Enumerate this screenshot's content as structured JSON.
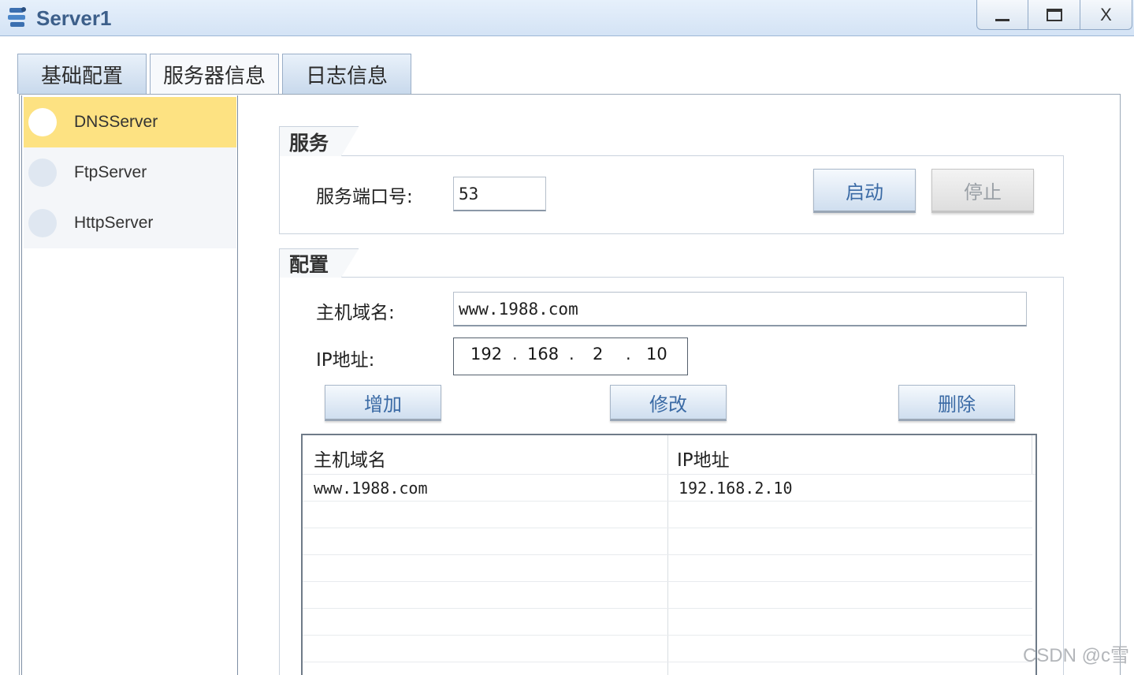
{
  "window": {
    "title": "Server1",
    "controls": {
      "minimize": "",
      "maximize": "",
      "close": "X"
    }
  },
  "tabs": [
    {
      "label": "基础配置"
    },
    {
      "label": "服务器信息",
      "selected": true
    },
    {
      "label": "日志信息"
    }
  ],
  "sidebar": {
    "items": [
      {
        "label": "DNSServer",
        "selected": true
      },
      {
        "label": "FtpServer"
      },
      {
        "label": "HttpServer"
      }
    ]
  },
  "service": {
    "group_title": "服务",
    "port_label": "服务端口号:",
    "port_value": "53",
    "start_label": "启动",
    "stop_label": "停止"
  },
  "config": {
    "group_title": "配置",
    "hostname_label": "主机域名:",
    "hostname_value": "www.1988.com",
    "ip_label": "IP地址:",
    "ip": [
      "192",
      "168",
      "2",
      "10"
    ],
    "add_label": "增加",
    "modify_label": "修改",
    "delete_label": "删除"
  },
  "table": {
    "headers": [
      "主机域名",
      "IP地址"
    ],
    "rows": [
      [
        "www.1988.com",
        "192.168.2.10"
      ]
    ]
  },
  "watermark": "CSDN @c雪",
  "colors": {
    "selected_item": "#fde282",
    "button_text": "#3a6aa5",
    "titlebar": "#d4e3f5"
  }
}
